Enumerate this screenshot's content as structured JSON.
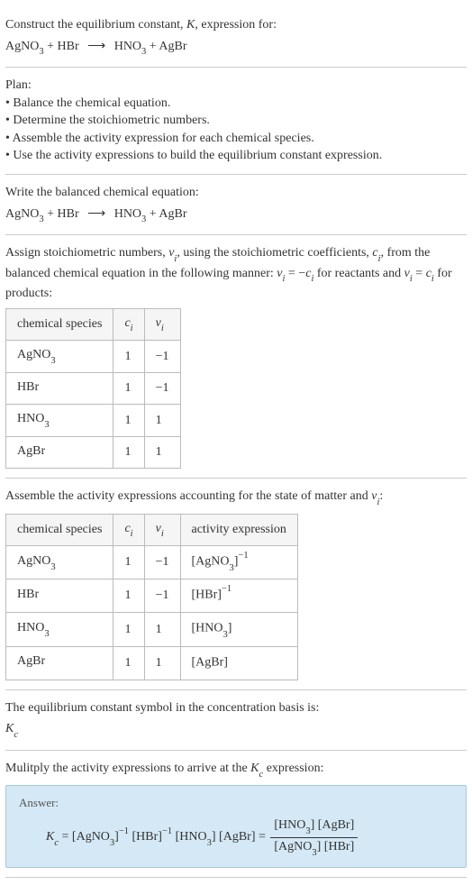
{
  "intro": {
    "line1": "Construct the equilibrium constant, ",
    "K": "K",
    "line1b": ", expression for:",
    "equation_lhs1": "AgNO",
    "equation_sub1": "3",
    "plus": " + ",
    "equation_lhs2": "HBr",
    "arrow": "⟶",
    "equation_rhs1": "HNO",
    "equation_sub2": "3",
    "equation_rhs2": "AgBr"
  },
  "plan": {
    "title": "Plan:",
    "b1": "• Balance the chemical equation.",
    "b2": "• Determine the stoichiometric numbers.",
    "b3": "• Assemble the activity expression for each chemical species.",
    "b4": "• Use the activity expressions to build the equilibrium constant expression."
  },
  "balanced": {
    "title": "Write the balanced chemical equation:"
  },
  "assign": {
    "text1": "Assign stoichiometric numbers, ",
    "nu": "ν",
    "sub_i": "i",
    "text2": ", using the stoichiometric coefficients, ",
    "c": "c",
    "text3": ", from the balanced chemical equation in the following manner: ",
    "eq1a": "ν",
    "eq1b": " = −",
    "eq1c": "c",
    "text4": " for reactants and ",
    "eq2a": "ν",
    "eq2b": " = ",
    "eq2c": "c",
    "text5": " for products:",
    "headers": {
      "h1": "chemical species",
      "h2": "c",
      "h2sub": "i",
      "h3": "ν",
      "h3sub": "i"
    },
    "rows": [
      {
        "species": "AgNO",
        "sub": "3",
        "c": "1",
        "nu": "−1"
      },
      {
        "species": "HBr",
        "sub": "",
        "c": "1",
        "nu": "−1"
      },
      {
        "species": "HNO",
        "sub": "3",
        "c": "1",
        "nu": "1"
      },
      {
        "species": "AgBr",
        "sub": "",
        "c": "1",
        "nu": "1"
      }
    ]
  },
  "activity": {
    "text1": "Assemble the activity expressions accounting for the state of matter and ",
    "nu": "ν",
    "sub_i": "i",
    "colon": ":",
    "headers": {
      "h1": "chemical species",
      "h2": "c",
      "h2sub": "i",
      "h3": "ν",
      "h3sub": "i",
      "h4": "activity expression"
    },
    "rows": [
      {
        "species": "AgNO",
        "sub": "3",
        "c": "1",
        "nu": "−1",
        "act": "[AgNO",
        "actsub": "3",
        "act2": "]",
        "exp": "−1"
      },
      {
        "species": "HBr",
        "sub": "",
        "c": "1",
        "nu": "−1",
        "act": "[HBr]",
        "actsub": "",
        "act2": "",
        "exp": "−1"
      },
      {
        "species": "HNO",
        "sub": "3",
        "c": "1",
        "nu": "1",
        "act": "[HNO",
        "actsub": "3",
        "act2": "]",
        "exp": ""
      },
      {
        "species": "AgBr",
        "sub": "",
        "c": "1",
        "nu": "1",
        "act": "[AgBr]",
        "actsub": "",
        "act2": "",
        "exp": ""
      }
    ]
  },
  "symbol": {
    "text": "The equilibrium constant symbol in the concentration basis is:",
    "K": "K",
    "sub": "c"
  },
  "multiply": {
    "text1": "Mulitply the activity expressions to arrive at the ",
    "K": "K",
    "sub": "c",
    "text2": " expression:"
  },
  "answer": {
    "label": "Answer:",
    "K": "K",
    "Ksub": "c",
    "eq": " = ",
    "t1": "[AgNO",
    "t1sub": "3",
    "t1b": "]",
    "exp1": "−1",
    "sp": " ",
    "t2": "[HBr]",
    "exp2": "−1",
    "t3": "[HNO",
    "t3sub": "3",
    "t3b": "]",
    "t4": "[AgBr]",
    "eq2": " = ",
    "num1": "[HNO",
    "num1sub": "3",
    "num1b": "] [AgBr]",
    "den1": "[AgNO",
    "den1sub": "3",
    "den1b": "] [HBr]"
  }
}
